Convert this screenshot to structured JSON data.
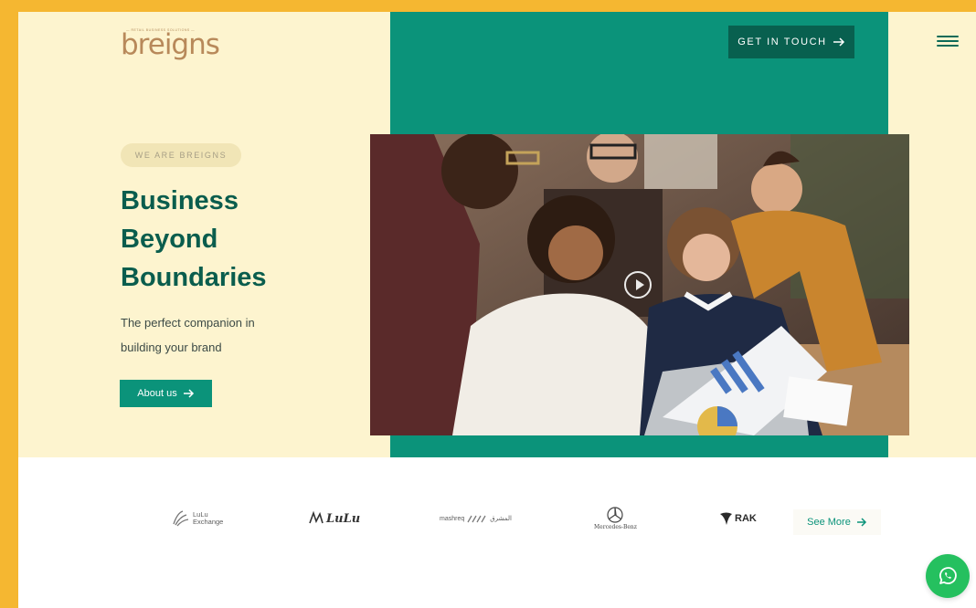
{
  "header": {
    "logo_tagline": "— RETAIL BUSINESS SOLUTIONS —",
    "logo_text": "breigns",
    "cta_label": "GET IN TOUCH",
    "menu_icon": "hamburger-menu-icon"
  },
  "hero": {
    "eyebrow": "WE ARE BREIGNS",
    "headline": [
      "Business",
      "Beyond",
      "Boundaries"
    ],
    "subtext_lines": [
      "The perfect companion in",
      "building your brand"
    ],
    "about_label": "About us",
    "play_icon": "play-icon"
  },
  "partners": {
    "logos": [
      {
        "name": "lulu-exchange",
        "line1": "LuLu",
        "line2": "Exchange"
      },
      {
        "name": "lulu",
        "text": "LuLu"
      },
      {
        "name": "mashreq",
        "text": "mashreq",
        "arabic": "المشرق"
      },
      {
        "name": "mercedes-benz",
        "text": "Mercedes-Benz"
      },
      {
        "name": "rak",
        "text": "RAK"
      }
    ],
    "see_more_label": "See More"
  },
  "colors": {
    "outer_bg": "#f5b731",
    "hero_bg": "#fdf4cf",
    "accent_green": "#0b937a",
    "dark_green": "#08604f",
    "headline": "#0a5d4d",
    "logo_gold": "#b8895a",
    "whatsapp": "#25c05f"
  },
  "floating": {
    "whatsapp_icon": "whatsapp-icon"
  }
}
